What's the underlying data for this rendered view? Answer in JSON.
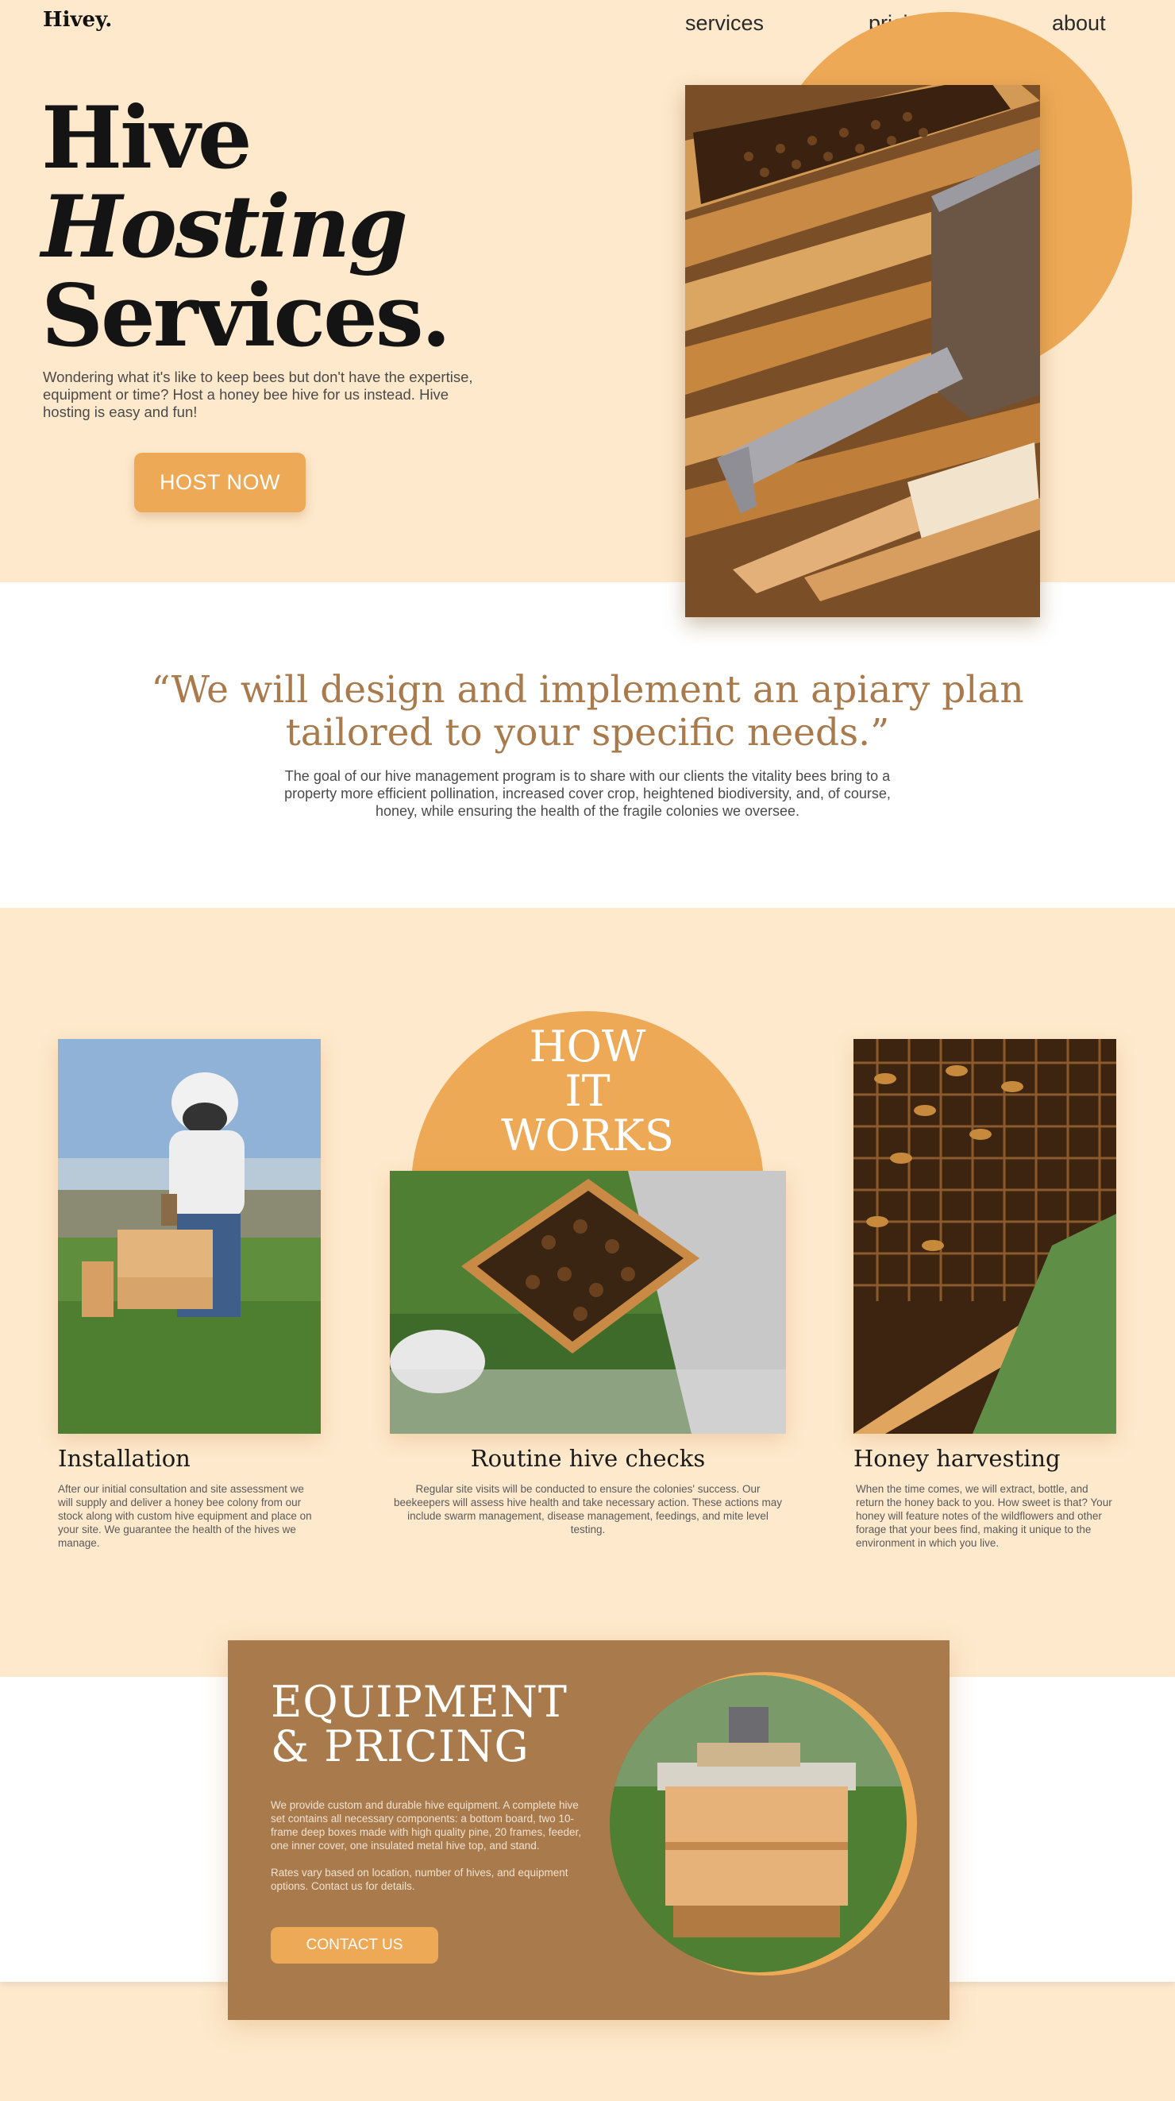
{
  "header": {
    "logo": "Hivey.",
    "nav": [
      "services",
      "pricing",
      "about"
    ]
  },
  "hero": {
    "title_line1": "Hive",
    "title_line2": "Hosting",
    "title_line3": "Services.",
    "description": "Wondering what it's like to keep bees but don't have the expertise, equipment or time?  Host a honey bee hive for us instead. Hive hosting is easy and fun!",
    "cta": "HOST NOW"
  },
  "quote": {
    "text": "“We will design and implement an apiary plan tailored to your specific needs.”",
    "body": "The goal of our hive management program is to share with our clients the vitality bees bring to a property more efficient pollination, increased cover crop, heightened biodiversity, and, of course, honey, while ensuring the health of the fragile colonies we oversee."
  },
  "how_it_works": {
    "title_line1": "HOW",
    "title_line2": "IT",
    "title_line3": "WORKS",
    "cards": [
      {
        "title": "Installation",
        "text": "After our initial consultation and site assessment we will supply and deliver a honey bee colony from our stock along with custom hive equipment and place on your site. We guarantee the health of the hives we manage."
      },
      {
        "title": "Routine hive checks",
        "text": "Regular site visits will be conducted to ensure the colonies' success. Our beekeepers will assess hive health and take necessary action. These actions may include swarm management, disease management, feedings, and mite level testing."
      },
      {
        "title": "Honey harvesting",
        "text": "When the time comes, we will extract, bottle, and return the honey back to you. How sweet is that? Your honey will feature notes of the wildflowers and other forage that your bees find, making it unique to the environment in which you live."
      }
    ]
  },
  "equipment": {
    "title_line1": "EQUIPMENT",
    "title_line2": "& PRICING",
    "para1": "We provide custom and durable hive equipment. A complete hive set contains all necessary components: a bottom board, two 10-frame deep boxes made with high quality pine, 20 frames, feeder, one inner cover, one insulated metal hive top, and stand.",
    "para2": "Rates vary based on location, number of hives, and equipment options. Contact us for details.",
    "cta": "CONTACT US"
  },
  "colors": {
    "background": "#fee9cc",
    "accent": "#eea956",
    "brown": "#a87a4c",
    "text": "#2a2a2a"
  }
}
